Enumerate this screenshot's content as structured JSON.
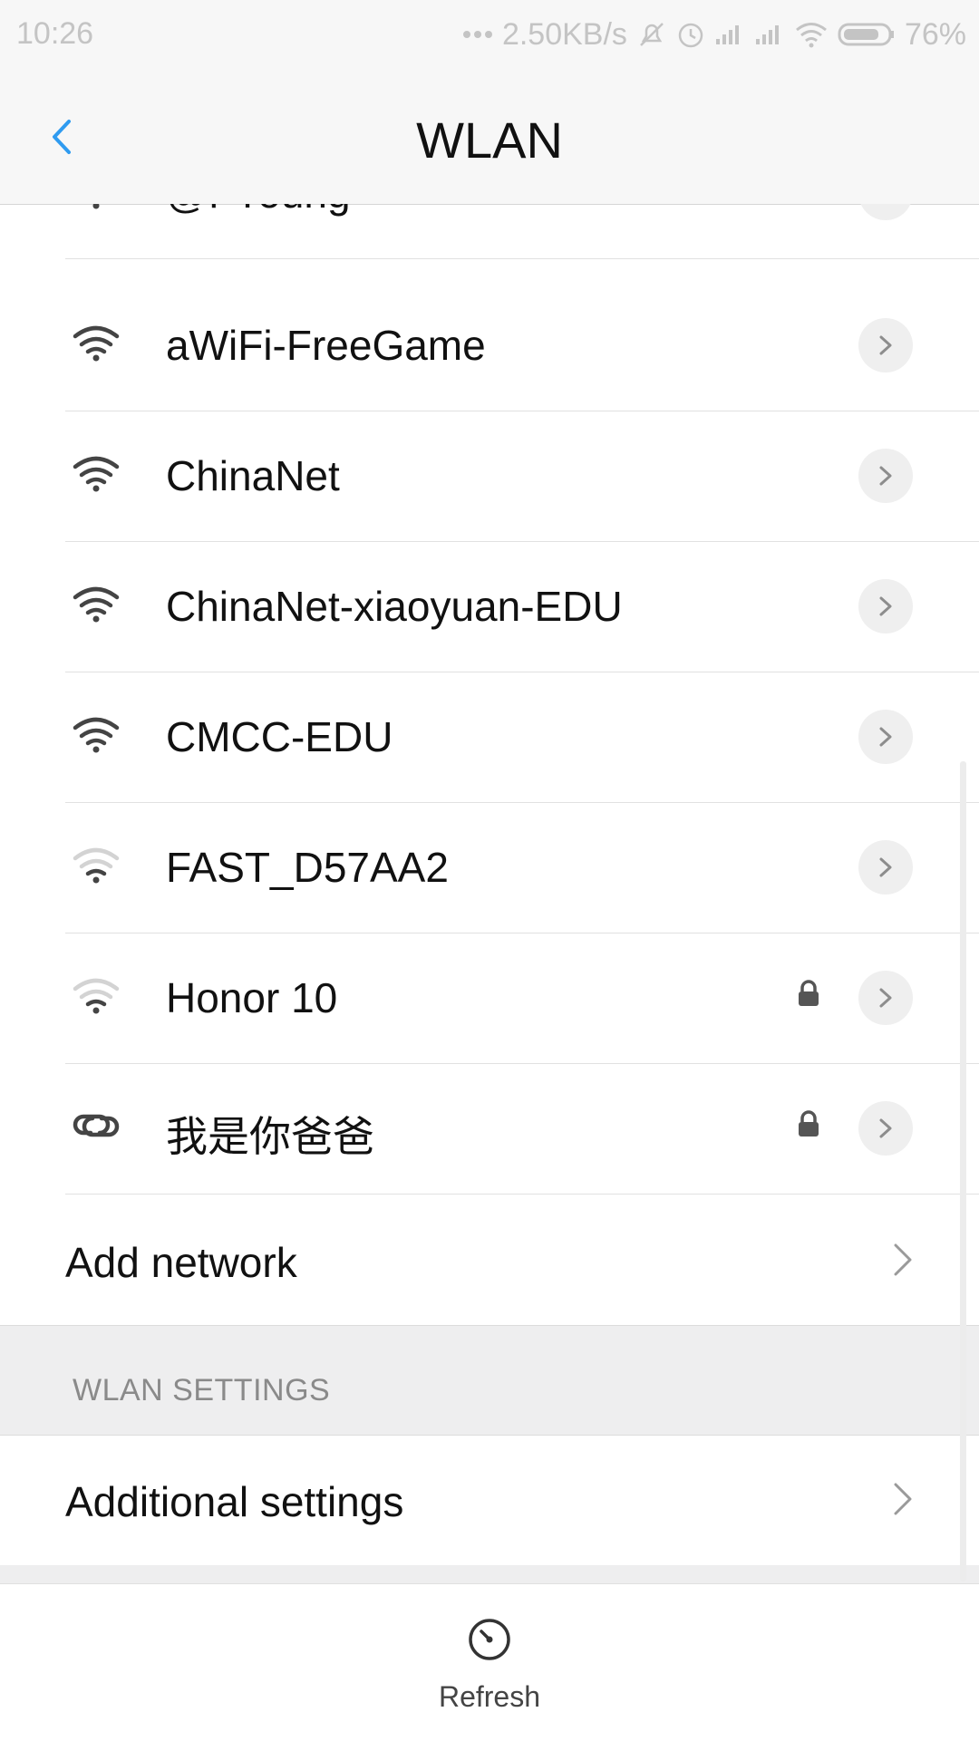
{
  "status_bar": {
    "time": "10:26",
    "speed": "2.50KB/s",
    "battery": "76%",
    "icons": [
      "more-dots-icon",
      "mute-icon",
      "alarm-icon",
      "signal-icon",
      "signal-icon",
      "wifi-icon",
      "battery-icon"
    ]
  },
  "header": {
    "title": "WLAN",
    "back_icon": "chevron-left-icon"
  },
  "networks": [
    {
      "name": "@f-Young",
      "signal": "strong",
      "locked": false
    },
    {
      "name": "aWiFi-FreeGame",
      "signal": "strong",
      "locked": false
    },
    {
      "name": "ChinaNet",
      "signal": "strong",
      "locked": false
    },
    {
      "name": "ChinaNet-xiaoyuan-EDU",
      "signal": "strong",
      "locked": false
    },
    {
      "name": "CMCC-EDU",
      "signal": "strong",
      "locked": false
    },
    {
      "name": "FAST_D57AA2",
      "signal": "weak",
      "locked": false
    },
    {
      "name": "Honor 10",
      "signal": "weak",
      "locked": true
    },
    {
      "name": "我是你爸爸",
      "signal": "link",
      "locked": true
    }
  ],
  "add_network": {
    "label": "Add network"
  },
  "section": {
    "label": "WLAN SETTINGS"
  },
  "additional_settings": {
    "label": "Additional settings"
  },
  "bottom": {
    "refresh_label": "Refresh",
    "refresh_icon": "refresh-icon"
  },
  "colors": {
    "accent": "#2f9bf0",
    "text": "#111111",
    "muted": "#8a8a8a",
    "background": "#f7f7f7"
  }
}
